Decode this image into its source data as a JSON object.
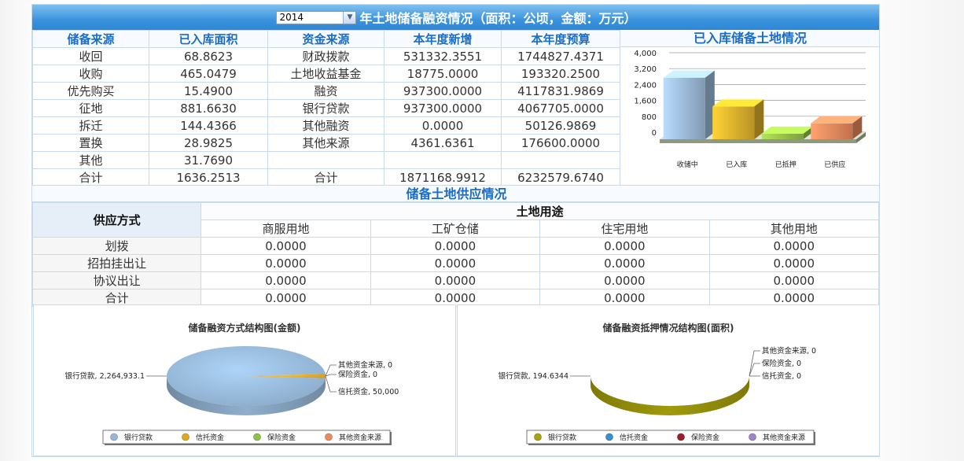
{
  "header": {
    "year": "2014",
    "title": "年土地储备融资情况（面积：公顷，金额：万元）"
  },
  "reserve_table": {
    "headers": [
      "储备来源",
      "已入库面积",
      "资金来源",
      "本年度新增",
      "本年度预算"
    ],
    "rows": [
      [
        "收回",
        "68.8623",
        "财政拨款",
        "531332.3551",
        "1744827.4371"
      ],
      [
        "收购",
        "465.0479",
        "土地收益基金",
        "18775.0000",
        "193320.2500"
      ],
      [
        "优先购买",
        "15.4900",
        "融资",
        "937300.0000",
        "4117831.9869"
      ],
      [
        "征地",
        "881.6630",
        "银行贷款",
        "937300.0000",
        "4067705.0000"
      ],
      [
        "拆迁",
        "144.4366",
        "其他融资",
        "0.0000",
        "50126.9869"
      ],
      [
        "置换",
        "28.9825",
        "其他来源",
        "4361.6361",
        "176600.0000"
      ],
      [
        "其他",
        "31.7690",
        "",
        "",
        ""
      ],
      [
        "合计",
        "1636.2513",
        "合计",
        "1871168.9912",
        "6232579.6740"
      ]
    ]
  },
  "stock_chart": {
    "heading": "已入库储备土地情况",
    "chart_data": {
      "type": "bar",
      "categories": [
        "收储中",
        "已入库",
        "已抵押",
        "已供应"
      ],
      "values": [
        3100,
        1650,
        280,
        800
      ],
      "ylim": [
        0,
        4000
      ],
      "yticks": [
        "0",
        "800",
        "1,600",
        "2,400",
        "3,200",
        "4,000"
      ],
      "colors": [
        "#9dbbd9",
        "#e0b32d",
        "#99c24a",
        "#ec8a5e"
      ]
    }
  },
  "supply": {
    "heading": "储备土地供应情况",
    "method_label": "供应方式",
    "usage_label": "土地用途",
    "usage_columns": [
      "商服用地",
      "工矿仓储",
      "住宅用地",
      "其他用地"
    ],
    "rows": [
      {
        "label": "划拨",
        "values": [
          "0.0000",
          "0.0000",
          "0.0000",
          "0.0000"
        ]
      },
      {
        "label": "招拍挂出让",
        "values": [
          "0.0000",
          "0.0000",
          "0.0000",
          "0.0000"
        ]
      },
      {
        "label": "协议出让",
        "values": [
          "0.0000",
          "0.0000",
          "0.0000",
          "0.0000"
        ]
      },
      {
        "label": "合计",
        "values": [
          "0.0000",
          "0.0000",
          "0.0000",
          "0.0000"
        ]
      }
    ]
  },
  "pie_left": {
    "title": "储备融资方式结构图(金额)",
    "chart_data": {
      "type": "pie",
      "slices": [
        {
          "name": "银行贷款",
          "value": 2264933.1,
          "label": "银行贷款, 2,264,933.1",
          "color": "#96b8d8"
        },
        {
          "name": "信托资金",
          "value": 50000,
          "label": "信托资金, 50,000",
          "color": "#e0a81d"
        },
        {
          "name": "保险资金",
          "value": 0,
          "label": "保险资金, 0",
          "color": "#8fc04a"
        },
        {
          "name": "其他资金来源",
          "value": 0,
          "label": "其他资金来源, 0",
          "color": "#ec8a5e"
        }
      ],
      "legend": [
        "银行贷款",
        "信托资金",
        "保险资金",
        "其他资金来源"
      ]
    }
  },
  "pie_right": {
    "title": "储备融资抵押情况结构图(面积)",
    "chart_data": {
      "type": "pie",
      "slices": [
        {
          "name": "银行贷款",
          "value": 194.6344,
          "label": "银行贷款, 194.6344",
          "color": "#a8a20a"
        },
        {
          "name": "信托资金",
          "value": 0,
          "label": "信托资金, 0",
          "color": "#3a8fd0"
        },
        {
          "name": "保险资金",
          "value": 0,
          "label": "保险资金, 0",
          "color": "#9a1f2e"
        },
        {
          "name": "其他资金来源",
          "value": 0,
          "label": "其他资金来源, 0",
          "color": "#9f84c8"
        }
      ],
      "legend": [
        "银行贷款",
        "信托资金",
        "保险资金",
        "其他资金来源"
      ]
    }
  }
}
